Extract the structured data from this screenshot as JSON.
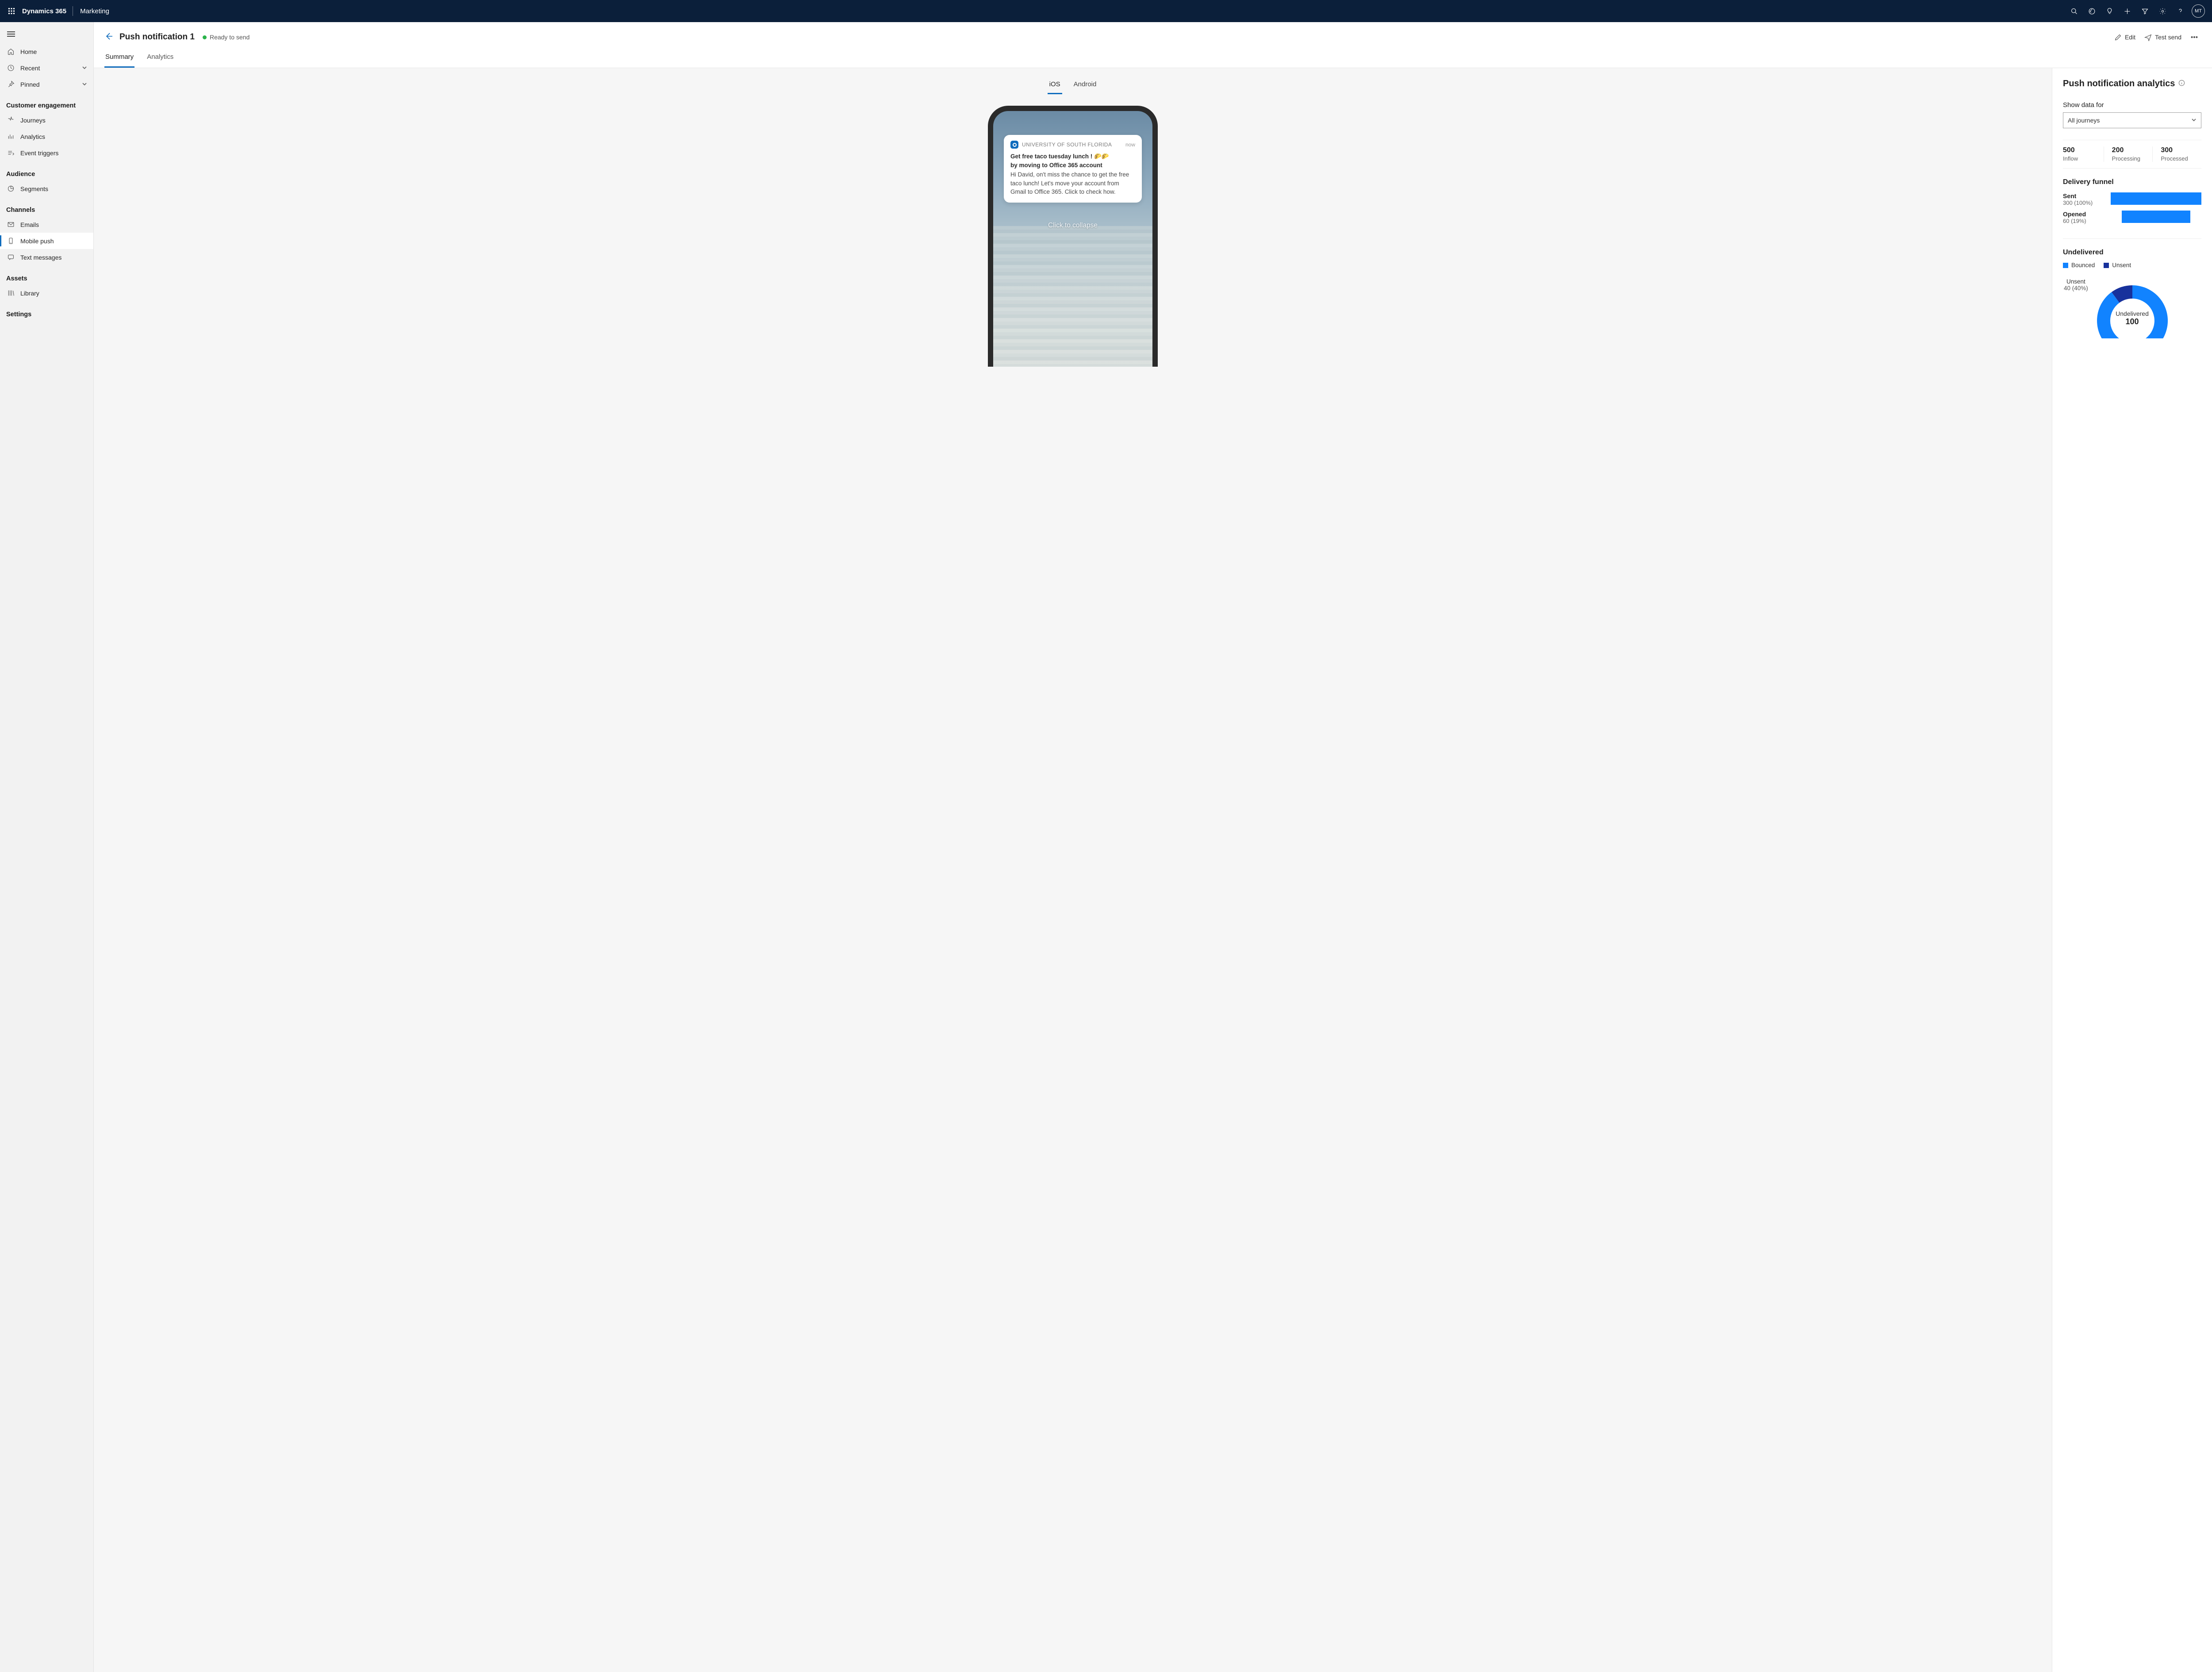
{
  "header": {
    "brand": "Dynamics 365",
    "module": "Marketing",
    "avatar": "MT"
  },
  "sidebar": {
    "nav_top": [
      {
        "label": "Home"
      },
      {
        "label": "Recent",
        "expandable": true
      },
      {
        "label": "Pinned",
        "expandable": true
      }
    ],
    "sections": [
      {
        "title": "Customer engagement",
        "items": [
          {
            "label": "Journeys"
          },
          {
            "label": "Analytics"
          },
          {
            "label": "Event triggers"
          }
        ]
      },
      {
        "title": "Audience",
        "items": [
          {
            "label": "Segments"
          }
        ]
      },
      {
        "title": "Channels",
        "items": [
          {
            "label": "Emails"
          },
          {
            "label": "Mobile push",
            "active": true
          },
          {
            "label": "Text messages"
          }
        ]
      },
      {
        "title": "Assets",
        "items": [
          {
            "label": "Library"
          }
        ]
      },
      {
        "title": "Settings",
        "items": []
      }
    ]
  },
  "page": {
    "title": "Push notification 1",
    "status": "Ready to send",
    "commands": {
      "edit": "Edit",
      "test_send": "Test send"
    },
    "tabs": [
      {
        "label": "Summary",
        "active": true
      },
      {
        "label": "Analytics"
      }
    ],
    "platform_tabs": [
      {
        "label": "iOS",
        "active": true
      },
      {
        "label": "Android"
      }
    ]
  },
  "notification": {
    "app_name": "UNIVERSITY OF SOUTH FLORIDA",
    "time": "now",
    "title_line1": "Get free taco tuesday lunch ! 🌮🌮",
    "title_line2": "by moving to Office 365 account",
    "body": "Hi David, on't miss the chance to get the free taco lunch! Let's move your account from Gmail to Office 365. Click to check how.",
    "collapse_hint": "Click to collapse"
  },
  "analytics": {
    "title": "Push notification analytics",
    "show_data_label": "Show data for",
    "show_data_value": "All journeys",
    "metrics": [
      {
        "value": "500",
        "label": "Inflow"
      },
      {
        "value": "200",
        "label": "Processing"
      },
      {
        "value": "300",
        "label": "Processed"
      }
    ],
    "funnel_title": "Delivery funnel",
    "funnel": [
      {
        "name": "Sent",
        "value": "300 (100%)",
        "pct": 100
      },
      {
        "name": "Opened",
        "value": "60 (19%)",
        "pct": 76,
        "offset": 12
      }
    ],
    "undelivered_title": "Undelivered",
    "legend": [
      {
        "label": "Bounced",
        "color": "#1183ff"
      },
      {
        "label": "Unsent",
        "color": "#17319c"
      }
    ],
    "donut": {
      "slice_label": "Unsent",
      "slice_value": "40 (40%)",
      "center_label": "Undelivered",
      "center_value": "100"
    }
  },
  "chart_data": [
    {
      "type": "bar",
      "title": "Delivery funnel",
      "categories": [
        "Sent",
        "Opened"
      ],
      "values": [
        300,
        60
      ],
      "percentages": [
        100,
        19
      ],
      "xlabel": "",
      "ylabel": ""
    },
    {
      "type": "pie",
      "title": "Undelivered",
      "total": 100,
      "series": [
        {
          "name": "Unsent",
          "value": 40,
          "pct": 40,
          "color": "#17319c"
        },
        {
          "name": "Bounced",
          "value": 60,
          "pct": 60,
          "color": "#1183ff"
        }
      ]
    }
  ]
}
